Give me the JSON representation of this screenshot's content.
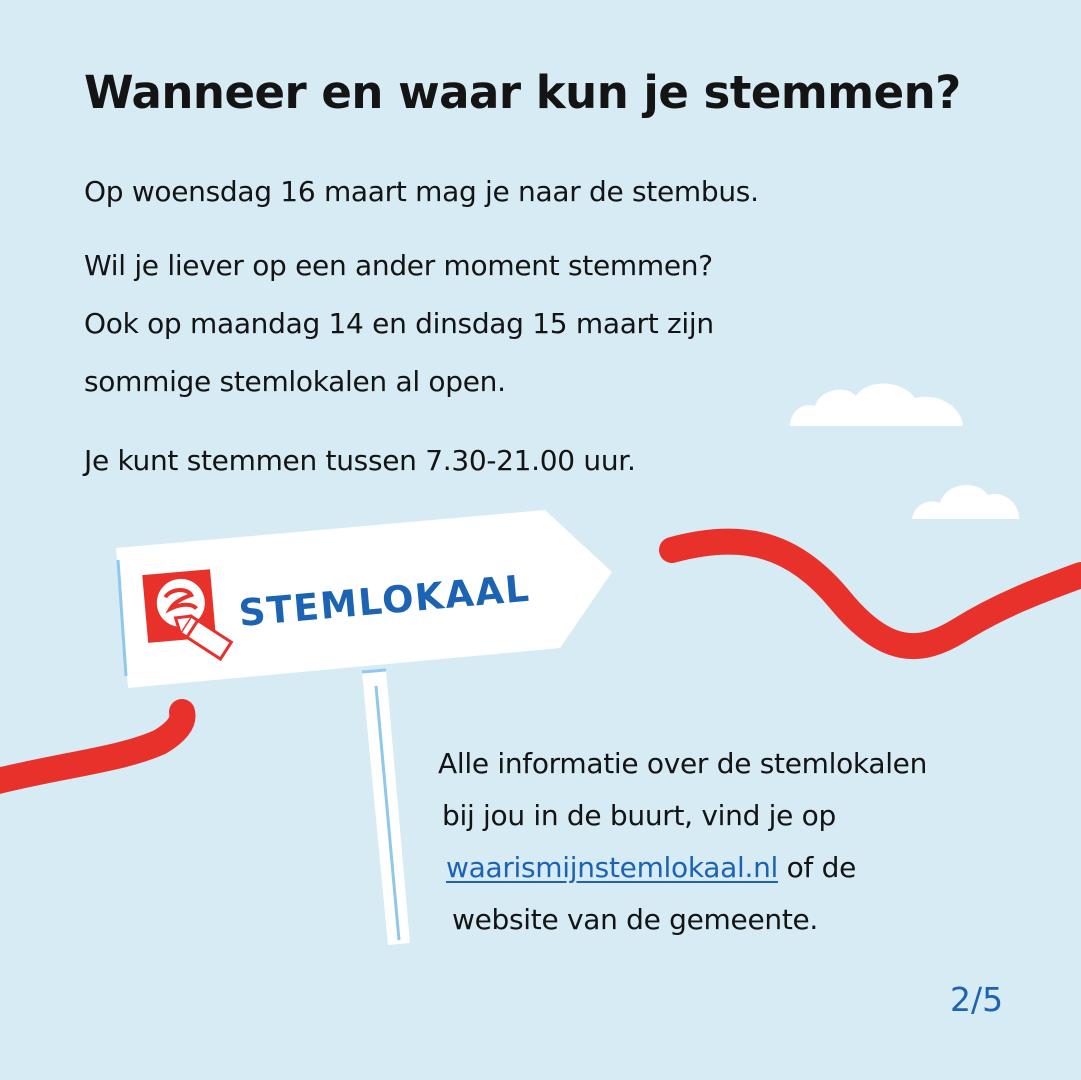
{
  "title": "Wanneer en waar kun je stemmen?",
  "paragraphs": {
    "p1": "Op woensdag 16 maart mag je naar de stembus.",
    "p2": [
      "Wil je liever op een ander moment stemmen?",
      "Ook op maandag 14 en dinsdag 15 maart zijn",
      "sommige stemlokalen al open."
    ],
    "p3": "Je kunt stemmen tussen 7.30-21.00 uur."
  },
  "sign": {
    "label": "STEMLOKAAL"
  },
  "info": {
    "line1": "Alle informatie over de stemlokalen",
    "line2": "bij jou in de buurt, vind je op",
    "link": "waarismijnstemlokaal.nl",
    "line3_suffix": " of de",
    "line4": "website van de gemeente."
  },
  "page_indicator": "2/5",
  "colors": {
    "background": "#d6ebf4",
    "ribbon": "#e8312a",
    "accent_blue": "#1c63b4",
    "sign": "#ffffff",
    "post_stripe": "#8fc8ea"
  },
  "icons": [
    "stemlokaal-logo-icon",
    "pencil-icon",
    "cloud-icon"
  ]
}
